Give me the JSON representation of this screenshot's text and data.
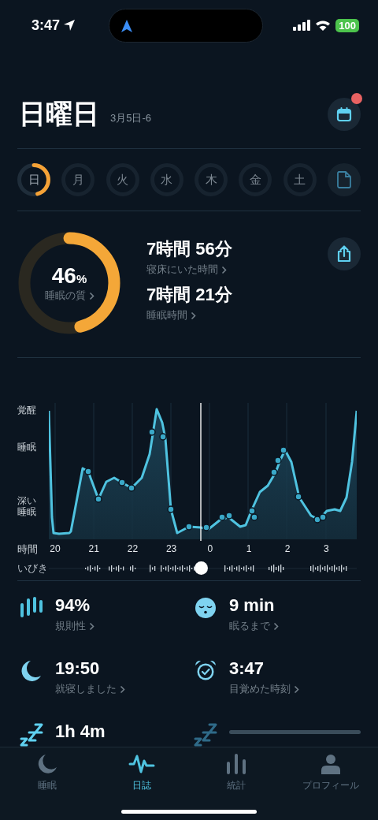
{
  "status_bar": {
    "time": "3:47",
    "battery": "100"
  },
  "header": {
    "title": "日曜日",
    "date": "3月5日-6",
    "calendar_badge": true
  },
  "days": [
    {
      "label": "日",
      "selected": true
    },
    {
      "label": "月",
      "selected": false
    },
    {
      "label": "火",
      "selected": false
    },
    {
      "label": "水",
      "selected": false
    },
    {
      "label": "木",
      "selected": false
    },
    {
      "label": "金",
      "selected": false
    },
    {
      "label": "土",
      "selected": false
    }
  ],
  "summary": {
    "quality": {
      "value": "46",
      "unit": "%",
      "label": "睡眠の質",
      "level": 0.46
    },
    "metrics": [
      {
        "value": "7時間 56分",
        "label": "寝床にいた時間"
      },
      {
        "value": "7時間 21分",
        "label": "睡眠時間"
      }
    ]
  },
  "graph": {
    "y_labels": [
      "覚醒",
      "睡眠",
      "深い睡眠"
    ],
    "x_title": "時間",
    "x_labels": [
      "20",
      "21",
      "22",
      "23",
      "0",
      "1",
      "2",
      "3"
    ],
    "snore_label": "いびき"
  },
  "stats": [
    {
      "kind": "value",
      "value": "94%",
      "label": "規則性"
    },
    {
      "kind": "value",
      "value": "9 min",
      "label": "眠るまで"
    },
    {
      "kind": "value",
      "value": "19:50",
      "label": "就寝しました"
    },
    {
      "kind": "value",
      "value": "3:47",
      "label": "目覚めた時刻"
    },
    {
      "kind": "value",
      "value": "1h  4m"
    },
    {
      "kind": "loading"
    }
  ],
  "tabs": [
    {
      "label": "睡眠",
      "selected": false
    },
    {
      "label": "日誌",
      "selected": true
    },
    {
      "label": "統計",
      "selected": false
    },
    {
      "label": "プロフィール",
      "selected": false
    }
  ]
}
